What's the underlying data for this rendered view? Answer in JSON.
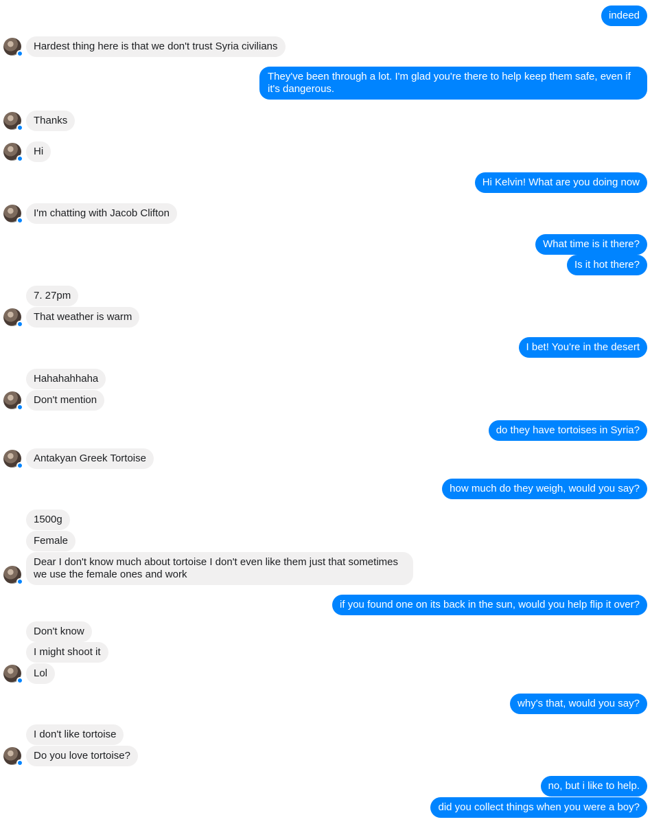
{
  "messages": [
    {
      "id": "m1",
      "side": "out",
      "text": "indeed"
    },
    {
      "id": "m2",
      "side": "in",
      "text": "Hardest thing here is that we don't trust Syria civilians"
    },
    {
      "id": "m3",
      "side": "out",
      "text": "They've been through a lot. I'm glad you're there to help keep them safe, even if it's dangerous."
    },
    {
      "id": "m4",
      "side": "in",
      "text": "Thanks"
    },
    {
      "id": "m5",
      "side": "in",
      "text": "Hi"
    },
    {
      "id": "m6",
      "side": "out",
      "text": "Hi Kelvin! What are you doing now"
    },
    {
      "id": "m7",
      "side": "in",
      "text": "I'm chatting with Jacob Clifton"
    },
    {
      "id": "m8",
      "side": "out",
      "text": "What time is it there?"
    },
    {
      "id": "m9",
      "side": "out",
      "text": "Is it hot there?"
    },
    {
      "id": "m10",
      "side": "in",
      "text": "7. 27pm"
    },
    {
      "id": "m11",
      "side": "in",
      "text": "That weather is warm"
    },
    {
      "id": "m12",
      "side": "out",
      "text": "I bet! You're in the desert"
    },
    {
      "id": "m13",
      "side": "in",
      "text": "Hahahahhaha"
    },
    {
      "id": "m14",
      "side": "in",
      "text": "Don't mention"
    },
    {
      "id": "m15",
      "side": "out",
      "text": "do they have tortoises in Syria?"
    },
    {
      "id": "m16",
      "side": "in",
      "text": "Antakyan Greek Tortoise"
    },
    {
      "id": "m17",
      "side": "out",
      "text": "how much do they weigh, would you say?"
    },
    {
      "id": "m18",
      "side": "in",
      "text": "1500g"
    },
    {
      "id": "m19",
      "side": "in",
      "text": "Female"
    },
    {
      "id": "m20",
      "side": "in",
      "text": "Dear I don't know much about tortoise I don't even like them just that sometimes we use the female ones and work"
    },
    {
      "id": "m21",
      "side": "out",
      "text": "if you found one on its back in the sun, would you help flip it over?"
    },
    {
      "id": "m22",
      "side": "in",
      "text": "Don't know"
    },
    {
      "id": "m23",
      "side": "in",
      "text": "I might shoot it"
    },
    {
      "id": "m24",
      "side": "in",
      "text": "Lol"
    },
    {
      "id": "m25",
      "side": "out",
      "text": "why's that, would you say?"
    },
    {
      "id": "m26",
      "side": "in",
      "text": "I don't like tortoise"
    },
    {
      "id": "m27",
      "side": "in",
      "text": "Do you love tortoise?"
    },
    {
      "id": "m28",
      "side": "out",
      "text": "no, but i like to help."
    },
    {
      "id": "m29",
      "side": "out",
      "text": "did you collect things when you were a boy?"
    }
  ],
  "colors": {
    "outgoing": "#0084ff",
    "incoming": "#f1f0f0"
  },
  "icons": {
    "avatar": "contact-avatar",
    "badge": "messenger-badge-icon"
  }
}
